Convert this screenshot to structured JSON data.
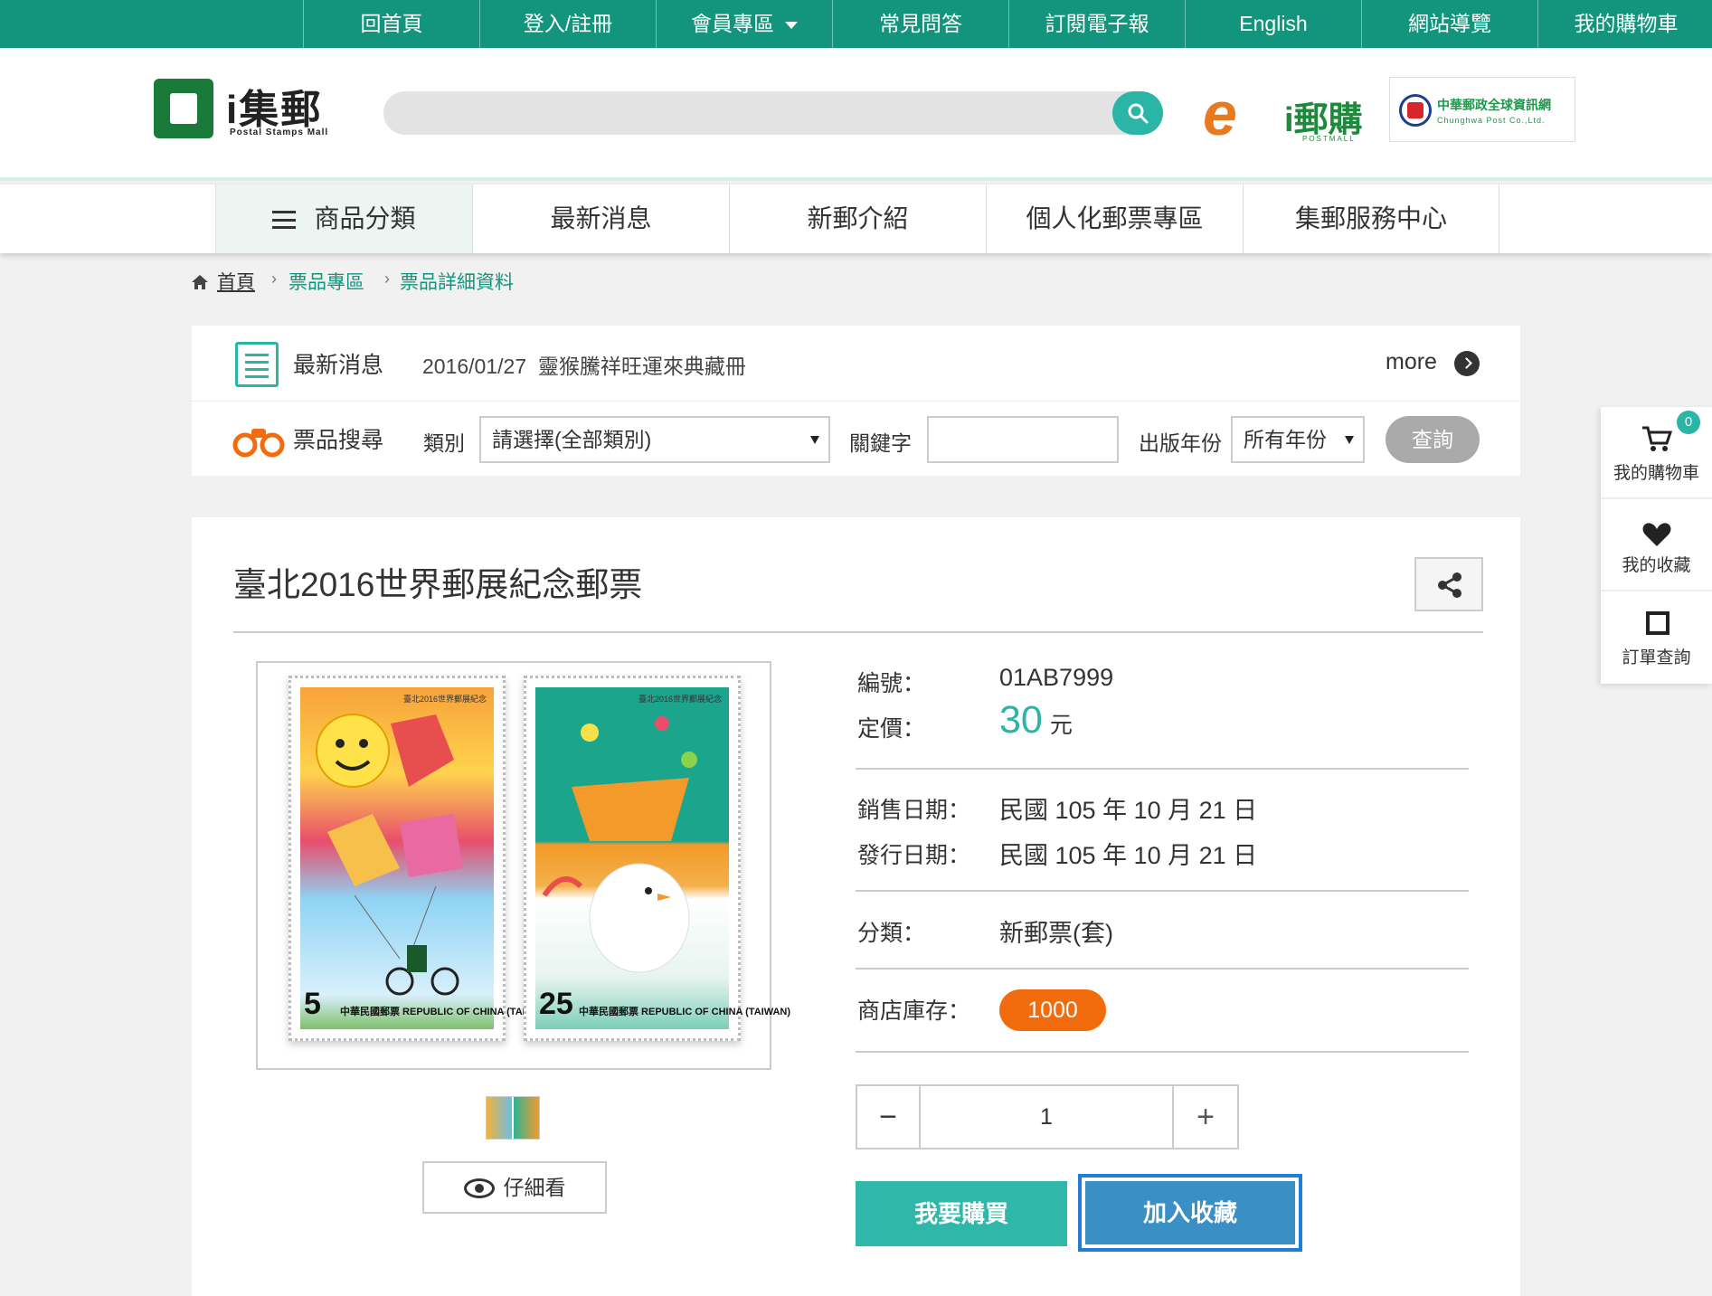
{
  "topnav": {
    "items": [
      {
        "label": "回首頁"
      },
      {
        "label": "登入/註冊"
      },
      {
        "label": "會員專區"
      },
      {
        "label": "常見問答"
      },
      {
        "label": "訂閱電子報"
      },
      {
        "label": "English"
      },
      {
        "label": "網站導覽"
      },
      {
        "label": "我的購物車"
      }
    ]
  },
  "header": {
    "logo_name": "i集郵",
    "logo_sub": "Postal Stamps Mall",
    "search_placeholder": "",
    "brand1_text": "i郵購",
    "brand1_sub": "POSTMALL",
    "brand2_line1": "中華郵政全球資訊網",
    "brand2_line2": "Chunghwa Post Co.,Ltd."
  },
  "mainnav": {
    "items": [
      {
        "label": "商品分類"
      },
      {
        "label": "最新消息"
      },
      {
        "label": "新郵介紹"
      },
      {
        "label": "個人化郵票專區"
      },
      {
        "label": "集郵服務中心"
      }
    ]
  },
  "breadcrumb": {
    "home": "首頁",
    "sep": "›",
    "level1": "票品專區",
    "level2": "票品詳細資料"
  },
  "news": {
    "label": "最新消息",
    "date": "2016/01/27",
    "headline": "靈猴騰祥旺運來典藏冊",
    "more": "more"
  },
  "stamp_search": {
    "label": "票品搜尋",
    "category_label": "類別",
    "category_value": "請選擇(全部類別)",
    "keyword_label": "關鍵字",
    "keyword_value": "",
    "year_label": "出版年份",
    "year_value": "所有年份",
    "query_label": "查詢"
  },
  "product": {
    "title": "臺北2016世界郵展紀念郵票",
    "stamps": [
      {
        "value": "5",
        "caption": "中華民國郵票 REPUBLIC OF CHINA (TAIWAN)",
        "top_caption": "臺北2016世界郵展紀念"
      },
      {
        "value": "25",
        "caption": "中華民國郵票 REPUBLIC OF CHINA (TAIWAN)",
        "top_caption": "臺北2016世界郵展紀念"
      }
    ],
    "detail_button": "仔細看",
    "code_label": "編號：",
    "code_value": "01AB7999",
    "price_label": "定價：",
    "price_value": "30",
    "price_unit": "元",
    "sale_date_label": "銷售日期：",
    "sale_date_value": "民國 105 年 10 月 21 日",
    "issue_date_label": "發行日期：",
    "issue_date_value": "民國 105 年 10 月 21 日",
    "category_label": "分類：",
    "category_value": "新郵票(套)",
    "stock_label": "商店庫存：",
    "stock_value": "1000",
    "quantity": "1",
    "minus_label": "−",
    "plus_label": "+",
    "buy_button": "我要購買",
    "favorite_button": "加入收藏"
  },
  "side": {
    "cart_label": "我的購物車",
    "cart_count": "0",
    "favorites_label": "我的收藏",
    "orders_label": "訂單查詢"
  },
  "colors": {
    "brand_green": "#13947c",
    "accent_teal": "#2ab5a6",
    "stock_orange": "#f26c0d",
    "favorite_blue": "#3a8fc4"
  }
}
